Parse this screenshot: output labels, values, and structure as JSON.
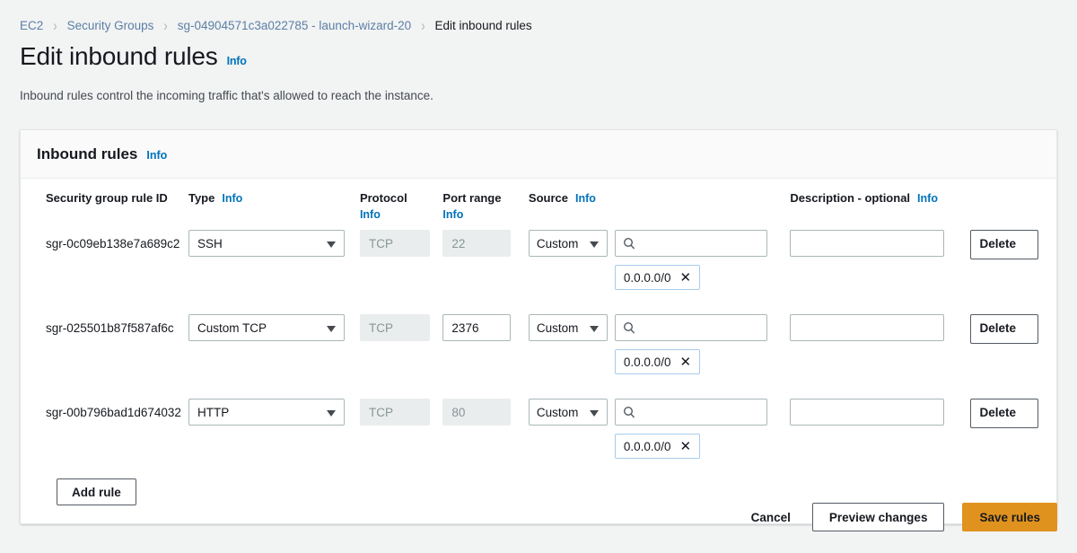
{
  "breadcrumb": {
    "items": [
      {
        "label": "EC2",
        "current": false
      },
      {
        "label": "Security Groups",
        "current": false
      },
      {
        "label": "sg-04904571c3a022785 - launch-wizard-20",
        "current": false
      },
      {
        "label": "Edit inbound rules",
        "current": true
      }
    ],
    "separator": "›"
  },
  "page": {
    "title": "Edit inbound rules",
    "info_label": "Info",
    "description": "Inbound rules control the incoming traffic that's allowed to reach the instance."
  },
  "card": {
    "title": "Inbound rules",
    "info_label": "Info"
  },
  "table": {
    "headers": {
      "rule_id": "Security group rule ID",
      "type": "Type",
      "type_info": "Info",
      "protocol": "Protocol",
      "protocol_info": "Info",
      "port_range": "Port range",
      "port_range_info": "Info",
      "source": "Source",
      "source_info": "Info",
      "description": "Description - optional",
      "description_info": "Info"
    },
    "rows": [
      {
        "rule_id": "sgr-0c09eb138e7a689c2",
        "type": "SSH",
        "protocol": "TCP",
        "protocol_disabled": true,
        "port_range": "22",
        "port_disabled": true,
        "source_type": "Custom",
        "source_search_value": "",
        "cidr": "0.0.0.0/0",
        "description": "",
        "delete_label": "Delete"
      },
      {
        "rule_id": "sgr-025501b87f587af6c",
        "type": "Custom TCP",
        "protocol": "TCP",
        "protocol_disabled": true,
        "port_range": "2376",
        "port_disabled": false,
        "source_type": "Custom",
        "source_search_value": "",
        "cidr": "0.0.0.0/0",
        "description": "",
        "delete_label": "Delete"
      },
      {
        "rule_id": "sgr-00b796bad1d674032",
        "type": "HTTP",
        "protocol": "TCP",
        "protocol_disabled": true,
        "port_range": "80",
        "port_disabled": true,
        "source_type": "Custom",
        "source_search_value": "",
        "cidr": "0.0.0.0/0",
        "description": "",
        "delete_label": "Delete"
      }
    ],
    "add_rule_label": "Add rule"
  },
  "footer": {
    "cancel_label": "Cancel",
    "preview_label": "Preview changes",
    "save_label": "Save rules"
  },
  "colors": {
    "accent_orange": "#e0921f",
    "link_blue": "#0073bb",
    "breadcrumb_blue": "#5b7fa6",
    "page_bg": "#f2f3f3",
    "token_border": "#a6cced"
  }
}
